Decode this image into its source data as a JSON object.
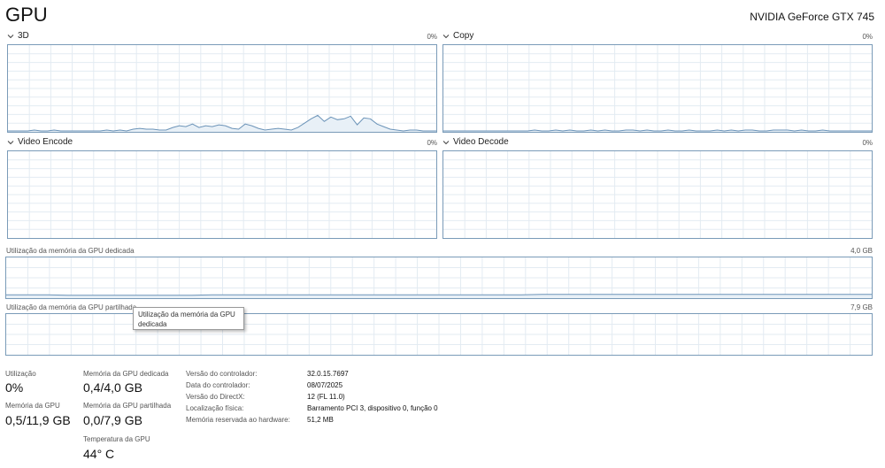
{
  "header": {
    "title": "GPU",
    "device": "NVIDIA GeForce GTX 745"
  },
  "engines": [
    {
      "name": "3D",
      "percent": "0%"
    },
    {
      "name": "Copy",
      "percent": "0%"
    },
    {
      "name": "Video Encode",
      "percent": "0%"
    },
    {
      "name": "Video Decode",
      "percent": "0%"
    }
  ],
  "memory_graphs": {
    "dedicated_label": "Utilização da memória da GPU dedicada",
    "dedicated_max": "4,0 GB",
    "shared_label": "Utilização da memória da GPU partilhada",
    "shared_max": "7,9 GB"
  },
  "tooltip": {
    "text": "Utilização da memória da GPU dedicada"
  },
  "stats": {
    "utilization_label": "Utilização",
    "utilization_value": "0%",
    "gpu_memory_label": "Memória da GPU",
    "gpu_memory_value": "0,5/11,9 GB",
    "dedicated_label": "Memória da GPU dedicada",
    "dedicated_value": "0,4/4,0 GB",
    "shared_label": "Memória da GPU partilhada",
    "shared_value": "0,0/7,9 GB",
    "temperature_label": "Temperatura da GPU",
    "temperature_value": "44° C"
  },
  "info": [
    {
      "label": "Versão do controlador:",
      "value": "32.0.15.7697"
    },
    {
      "label": "Data do controlador:",
      "value": "08/07/2025"
    },
    {
      "label": "Versão do DirectX:",
      "value": "12 (FL 11.0)"
    },
    {
      "label": "Localização física:",
      "value": "Barramento PCI 3, dispositivo 0, função 0"
    },
    {
      "label": "Memória reservada ao hardware:",
      "value": "51,2 MB"
    }
  ],
  "series": {
    "engine_3d": [
      0,
      0,
      0,
      0,
      1,
      0,
      0,
      1,
      0,
      0,
      0,
      0,
      0,
      0,
      0,
      1,
      0,
      1,
      0,
      2,
      3,
      2,
      2,
      1,
      1,
      4,
      6,
      5,
      8,
      4,
      6,
      5,
      7,
      6,
      3,
      2,
      8,
      6,
      3,
      1,
      2,
      3,
      2,
      1,
      4,
      9,
      14,
      18,
      11,
      16,
      13,
      14,
      17,
      7,
      15,
      14,
      8,
      5,
      2,
      1,
      0,
      1,
      1,
      0,
      0,
      0
    ],
    "copy": [
      0,
      0,
      0,
      0,
      0,
      0,
      0,
      0,
      0,
      0,
      0,
      0,
      0,
      1,
      0,
      0,
      1,
      0,
      1,
      0,
      0,
      1,
      0,
      1,
      0,
      0,
      1,
      1,
      0,
      1,
      0,
      0,
      1,
      0,
      0,
      1,
      0,
      0,
      0,
      1,
      0,
      1,
      0,
      1,
      1,
      0,
      0,
      1,
      1,
      1,
      0,
      1,
      0,
      0,
      1,
      0,
      0,
      0,
      0,
      0,
      0,
      0
    ],
    "video_encode": [],
    "video_decode": [],
    "dedicated_memory": [
      6,
      6,
      6,
      5,
      5,
      5,
      5,
      5,
      5,
      5,
      6,
      6,
      6,
      6,
      6,
      6,
      6,
      6,
      6,
      6,
      6,
      6,
      6,
      6,
      6,
      6,
      7,
      7,
      7,
      7,
      7,
      7,
      7,
      7,
      7,
      7,
      7,
      7,
      7,
      7,
      7,
      7,
      7
    ],
    "shared_memory": []
  }
}
